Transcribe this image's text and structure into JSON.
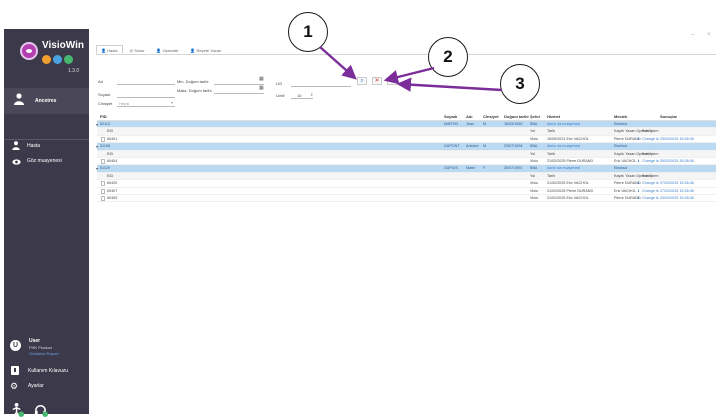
{
  "app": {
    "name": "VisioWin",
    "version": "1.3.0",
    "dot_colors": [
      "#f0a030",
      "#4aa3e0",
      "#48b870"
    ]
  },
  "sidebar": {
    "user_section_label": "Ancetres",
    "items": [
      {
        "label": "Hasta",
        "icon": "person-icon"
      },
      {
        "label": "Göz muayenesi",
        "icon": "eye-icon"
      }
    ],
    "user": {
      "avatar_letter": "U",
      "name": "User",
      "sub": "FHK Product",
      "role": "Ortalama Raport"
    },
    "bottom_items": [
      {
        "label": "Kullanım Kılavuzu",
        "icon": "manual-icon"
      },
      {
        "label": "Ayarlar",
        "icon": "gear-icon"
      }
    ]
  },
  "window": {
    "minimize": "–",
    "close": "×"
  },
  "tabs": [
    {
      "label": "Hasta",
      "icon": "person-icon",
      "active": true
    },
    {
      "label": "Sınav",
      "icon": "exam-icon",
      "active": false
    },
    {
      "label": "Operatör",
      "icon": "operator-icon",
      "active": false
    },
    {
      "label": "Reçete Yazan",
      "icon": "prescriber-icon",
      "active": false
    }
  ],
  "form": {
    "ad_label": "Ad",
    "soyadi_label": "Soyadı",
    "cinsiyet_label": "Cinsiyet",
    "cinsiyet_value": "Hepsi",
    "min_dob_label": "Min. Doğum tarihi",
    "max_dob_label": "Maks. Doğum tarihi",
    "lid_label": "LID",
    "limit_label": "Limit",
    "limit_value": "10"
  },
  "toolbar": {
    "search_symbol": "⌕",
    "clear_symbol": "✕",
    "eraser_symbol": "⌫"
  },
  "callouts": [
    "1",
    "2",
    "3"
  ],
  "table": {
    "headers": [
      "PID",
      "Soyadı",
      "Adı",
      "Cinsiyet",
      "Doğum tarihi",
      "Şehri",
      "Hizmet",
      "Meslek",
      "Sonuçlar"
    ],
    "rows": [
      {
        "kind": "group",
        "pid": "52113",
        "soyadi": "MARTIN",
        "adi": "Jean",
        "cins": "M",
        "dogum": "16/03/1960",
        "sehir": "BBA",
        "hizmet": "Akılın da muayenesi",
        "meslek": "Eksiksiz",
        "sonuc": ""
      },
      {
        "kind": "sub",
        "pid": "EID",
        "soyadi": "",
        "adi": "",
        "cins": "",
        "dogum": "",
        "sehir": "Yol",
        "hizmet": "Tarih",
        "meslek": "Kayıtlı Yazan   Operatör",
        "sonuc": "Son İşlem"
      },
      {
        "kind": "doc",
        "pid": "60401",
        "soyadi": "",
        "adi": "",
        "cins": "",
        "dogum": "",
        "sehir": "Visio",
        "hizmet": "10/09/2021   Eric VACHOL",
        "meslek": "Pierre DURAND",
        "sonuc": "Changé le 25/03/2025 15:28:08"
      },
      {
        "kind": "group",
        "pid": "31108",
        "soyadi": "DUPONT",
        "adi": "Antoine",
        "cins": "M",
        "dogum": "23/07/1994",
        "sehir": "BBA",
        "hizmet": "Akılın da muayenesi",
        "meslek": "Eksiksiz",
        "sonuc": ""
      },
      {
        "kind": "sub",
        "pid": "EID",
        "soyadi": "",
        "adi": "",
        "cins": "",
        "dogum": "",
        "sehir": "Yol",
        "hizmet": "Tarih",
        "meslek": "Kayıtlı Yazan   Operatör",
        "sonuc": "Son İşlem"
      },
      {
        "kind": "doc",
        "pid": "60404",
        "soyadi": "",
        "adi": "",
        "cins": "",
        "dogum": "",
        "sehir": "Visio",
        "hizmet": "21/02/2025   Pierre DURAND",
        "meslek": "Eric VACHOL",
        "sonuc": "Changé le 25/03/2025 15:28:08"
      },
      {
        "kind": "group",
        "pid": "51129",
        "soyadi": "DUPUIS",
        "adi": "Marie",
        "cins": "F",
        "dogum": "30/07/1991",
        "sehir": "BBA",
        "hizmet": "Akılın da muayenesi",
        "meslek": "Eksiksiz",
        "sonuc": ""
      },
      {
        "kind": "sub",
        "pid": "EID",
        "soyadi": "",
        "adi": "",
        "cins": "",
        "dogum": "",
        "sehir": "Yol",
        "hizmet": "Tarih",
        "meslek": "Kayıtlı Yazan   Operatör",
        "sonuc": "Son İşlem"
      },
      {
        "kind": "doc",
        "pid": "60420",
        "soyadi": "",
        "adi": "",
        "cins": "",
        "dogum": "",
        "sehir": "Visio",
        "hizmet": "21/02/2025   Eric VACHOL",
        "meslek": "Pierre DURAND",
        "sonuc": "Changé le 27/03/2025 15:28:08"
      },
      {
        "kind": "doc",
        "pid": "60407",
        "soyadi": "",
        "adi": "",
        "cins": "",
        "dogum": "",
        "sehir": "Visio",
        "hizmet": "21/02/2025   Pierre DURAND",
        "meslek": "Eric VACHOL",
        "sonuc": "Changé le 27/03/2025 15:28:08"
      },
      {
        "kind": "doc",
        "pid": "60409",
        "soyadi": "",
        "adi": "",
        "cins": "",
        "dogum": "",
        "sehir": "Visio",
        "hizmet": "21/02/2025   Eric VACHOL",
        "meslek": "Pierre DURAND",
        "sonuc": "Changé le 25/03/2025 15:28:08"
      }
    ]
  }
}
